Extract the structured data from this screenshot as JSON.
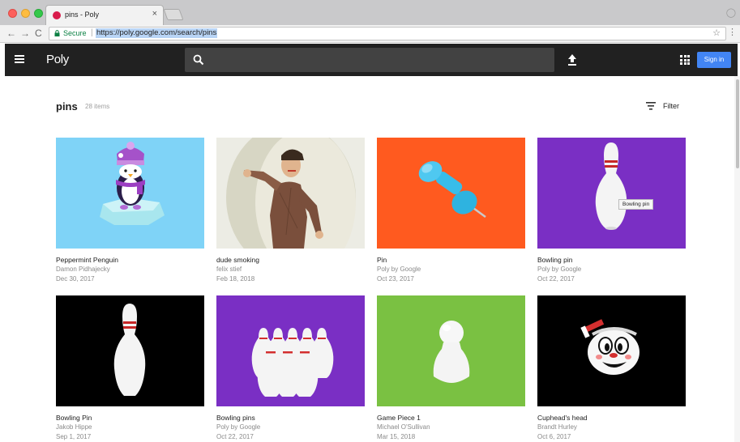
{
  "browser": {
    "tab_title": "pins - Poly",
    "tab_close": "×",
    "secure_label": "Secure",
    "url": "https://poly.google.com/search/pins",
    "nav_back": "←",
    "nav_forward": "→",
    "nav_reload": "C",
    "star": "☆",
    "menu": "⋮"
  },
  "header": {
    "brand": "Poly",
    "search_placeholder": "",
    "signin_label": "Sign in"
  },
  "results": {
    "query": "pins",
    "count": "28 items",
    "filter_label": "Filter"
  },
  "cards": [
    {
      "title": "Peppermint Penguin",
      "author": "Damon Pidhajecky",
      "date": "Dec 30, 2017"
    },
    {
      "title": "dude smoking",
      "author": "felix stief",
      "date": "Feb 18, 2018"
    },
    {
      "title": "Pin",
      "author": "Poly by Google",
      "date": "Oct 23, 2017"
    },
    {
      "title": "Bowling pin",
      "author": "Poly by Google",
      "date": "Oct 22, 2017",
      "tooltip": "Bowling pin"
    },
    {
      "title": "Bowling Pin",
      "author": "Jakob Hippe",
      "date": "Sep 1, 2017"
    },
    {
      "title": "Bowling pins",
      "author": "Poly by Google",
      "date": "Oct 22, 2017"
    },
    {
      "title": "Game Piece 1",
      "author": "Michael O'Sullivan",
      "date": "Mar 15, 2018"
    },
    {
      "title": "Cuphead's head",
      "author": "Brandt Hurley",
      "date": "Oct 6, 2017"
    }
  ],
  "colors": {
    "header_bg": "#212121",
    "search_bg": "#424242",
    "accent_blue": "#4285f4",
    "thumb_penguin_bg": "#7fd3f7",
    "thumb_pin_bg": "#ff5a1f",
    "thumb_bowling_bg": "#7a2fc4",
    "thumb_gamepiece_bg": "#7ac142",
    "thumb_black_bg": "#000000"
  },
  "icons": {
    "menu": "hamburger-icon",
    "search": "search-icon",
    "upload": "upload-icon",
    "apps": "apps-grid-icon",
    "filter": "filter-icon"
  }
}
